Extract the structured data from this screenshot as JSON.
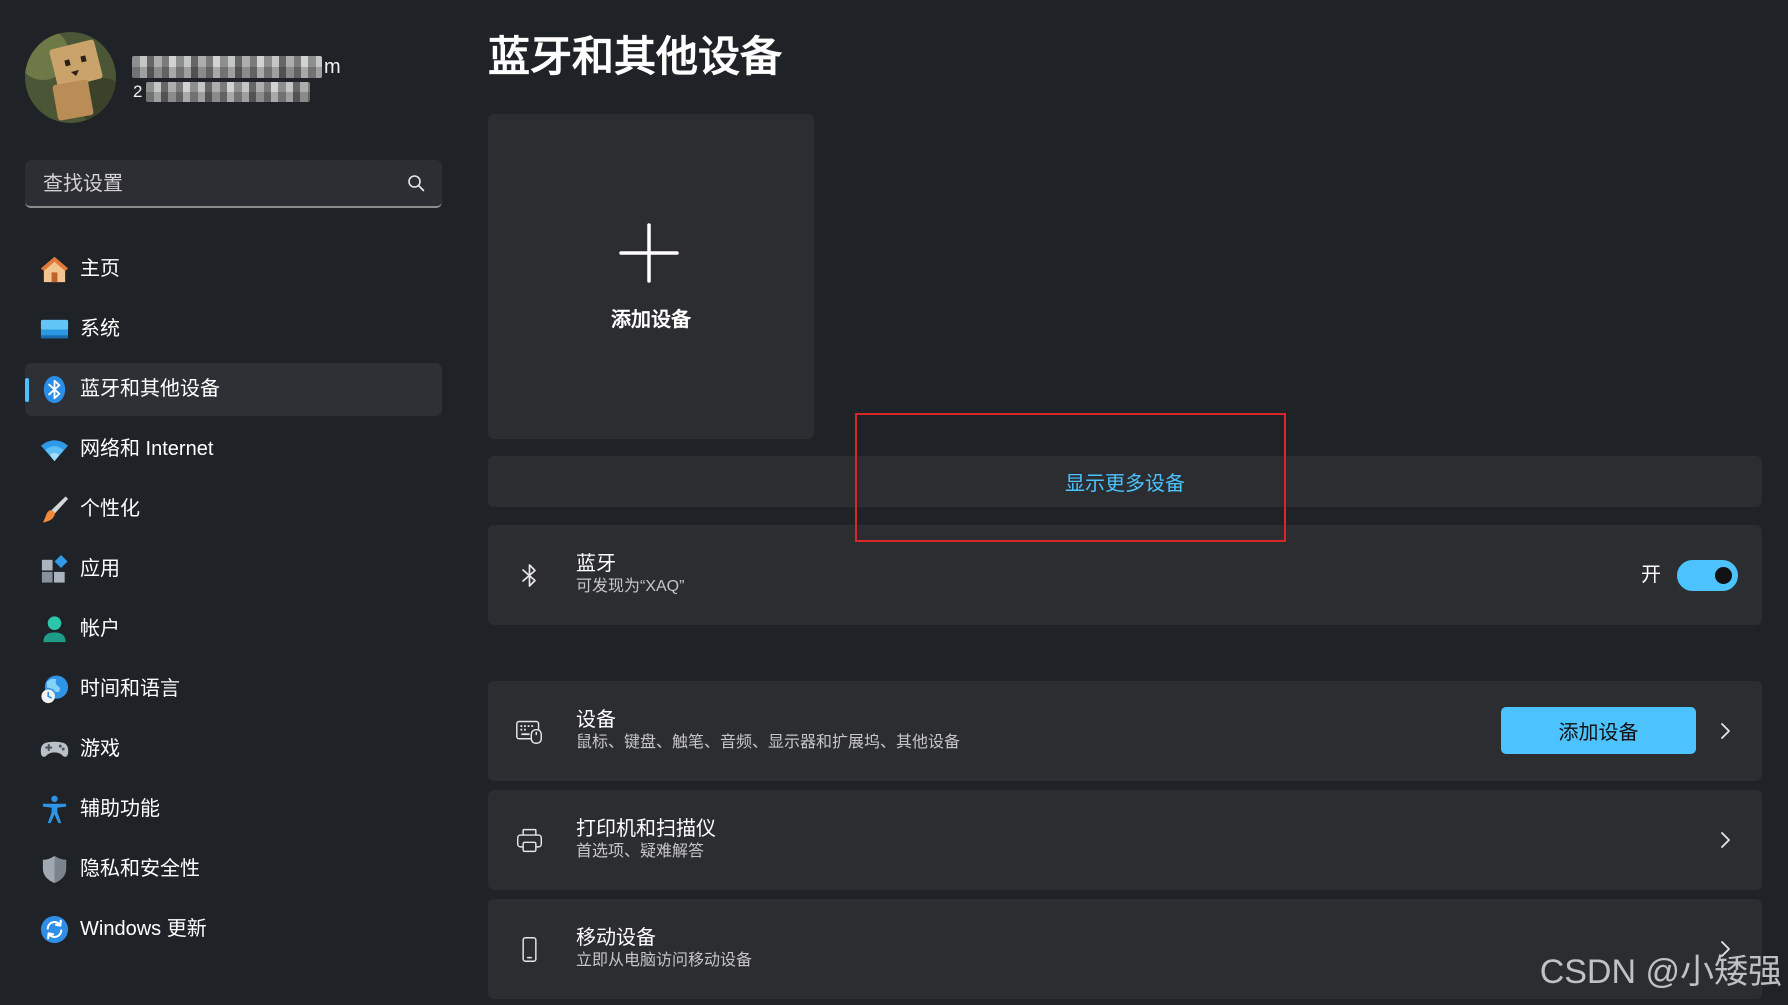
{
  "user": {
    "name_tail": "m",
    "email_head": "2",
    "avatar_icon": "user-avatar"
  },
  "search": {
    "placeholder": "查找设置",
    "icon": "search-icon"
  },
  "sidebar": {
    "items": [
      {
        "label": "主页",
        "icon": "home-icon",
        "selected": false
      },
      {
        "label": "系统",
        "icon": "system-monitor-icon",
        "selected": false
      },
      {
        "label": "蓝牙和其他设备",
        "icon": "bluetooth-icon",
        "selected": true
      },
      {
        "label": "网络和 Internet",
        "icon": "wifi-icon",
        "selected": false
      },
      {
        "label": "个性化",
        "icon": "brush-icon",
        "selected": false
      },
      {
        "label": "应用",
        "icon": "apps-icon",
        "selected": false
      },
      {
        "label": "帐户",
        "icon": "account-icon",
        "selected": false
      },
      {
        "label": "时间和语言",
        "icon": "time-language-icon",
        "selected": false
      },
      {
        "label": "游戏",
        "icon": "gaming-controller-icon",
        "selected": false
      },
      {
        "label": "辅助功能",
        "icon": "accessibility-icon",
        "selected": false
      },
      {
        "label": "隐私和安全性",
        "icon": "shield-icon",
        "selected": false
      },
      {
        "label": "Windows 更新",
        "icon": "windows-update-icon",
        "selected": false
      }
    ]
  },
  "page": {
    "title": "蓝牙和其他设备"
  },
  "add_device_tile": {
    "label": "添加设备",
    "icon": "plus-icon"
  },
  "show_more": {
    "label": "显示更多设备"
  },
  "bluetooth": {
    "title": "蓝牙",
    "subtitle": "可发现为“XAQ”",
    "state_label": "开",
    "enabled": true,
    "icon": "bluetooth-outline-icon"
  },
  "settings_cards": [
    {
      "title": "设备",
      "subtitle": "鼠标、键盘、触笔、音频、显示器和扩展坞、其他设备",
      "button_label": "添加设备",
      "icon": "keyboard-mouse-icon"
    },
    {
      "title": "打印机和扫描仪",
      "subtitle": "首选项、疑难解答",
      "icon": "printer-icon"
    },
    {
      "title": "移动设备",
      "subtitle": "立即从电脑访问移动设备",
      "icon": "phone-icon"
    }
  ],
  "watermark": {
    "text": "CSDN @小矮强"
  },
  "colors": {
    "background": "#1f2227",
    "card": "#2b2d31",
    "selected_nav": "#2d3035",
    "accent": "#4cc2ff",
    "annotation": "#d9262b",
    "subtext": "#c6c6c6"
  }
}
